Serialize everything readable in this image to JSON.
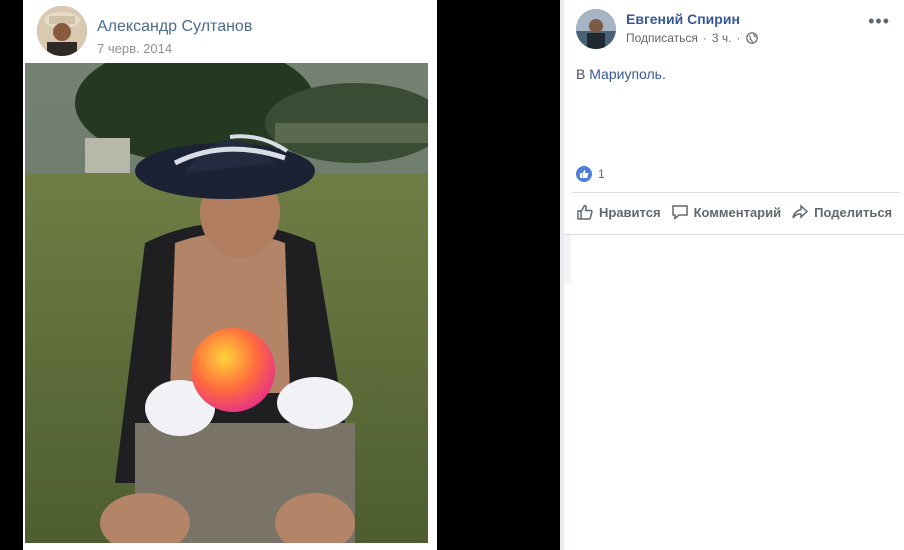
{
  "left_post": {
    "author": "Александр Султанов",
    "date": "7 черв. 2014"
  },
  "right_post": {
    "author": "Евгений Спирин",
    "subscribe_label": "Подписаться",
    "separator": "·",
    "time": "3 ч.",
    "text_prefix": "В ",
    "text_link": "Мариуполь",
    "text_suffix": ".",
    "like_count": "1",
    "actions": {
      "like": "Нравится",
      "comment": "Комментарий",
      "share": "Поделиться"
    },
    "more_label": "•••"
  },
  "colors": {
    "link": "#385898",
    "author_left": "#4a6b95",
    "like_blue": "#4f7dd8"
  }
}
